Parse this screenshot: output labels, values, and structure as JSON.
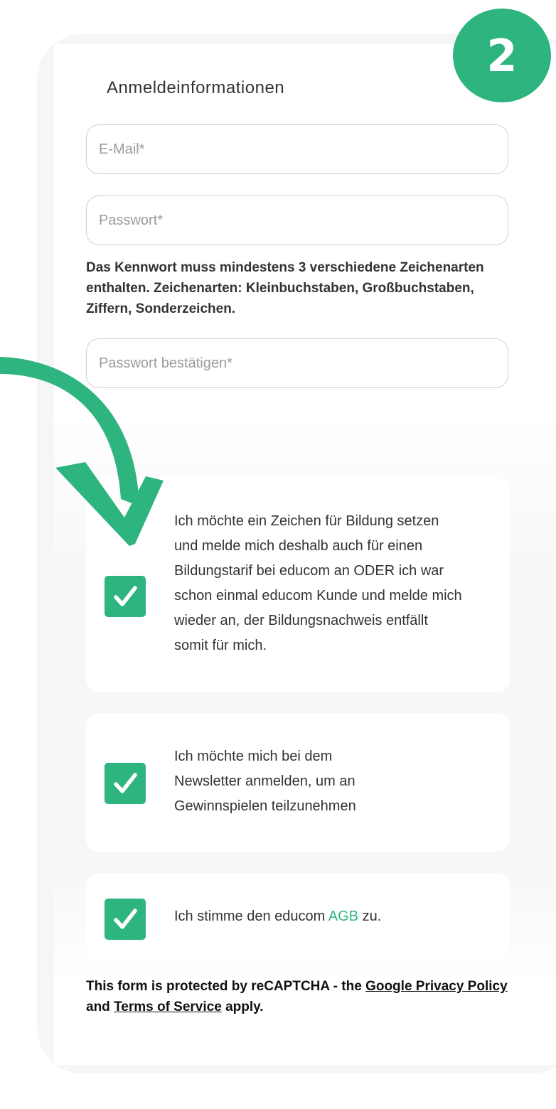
{
  "step": {
    "number": "2"
  },
  "section": {
    "title": "Anmeldeinformationen"
  },
  "fields": {
    "email_placeholder": "E-Mail*",
    "password_placeholder": "Passwort*",
    "password_confirm_placeholder": "Passwort bestätigen*"
  },
  "password_hint": "Das Kennwort muss mindestens 3 verschiedene Zeichenarten enthalten. Zeichenarten: Kleinbuchstaben, Großbuchstaben, Ziffern, Sonderzeichen.",
  "consents": {
    "education": {
      "checked": true,
      "text": "Ich möchte ein Zeichen für Bildung setzen und melde mich deshalb auch für einen Bildungstarif bei educom an ODER ich war schon einmal educom Kunde und melde mich wieder an, der Bildungsnachweis entfällt somit für mich."
    },
    "newsletter": {
      "checked": true,
      "text": "Ich möchte mich bei dem Newsletter anmelden, um an Gewinnspielen teilzunehmen"
    },
    "terms": {
      "checked": true,
      "text_before": "Ich stimme den educom ",
      "link": "AGB",
      "text_after": " zu."
    }
  },
  "recaptcha": {
    "text_before": "This form is protected by reCAPTCHA - the ",
    "privacy_link": "Google Privacy Policy",
    "text_middle": " and ",
    "terms_link": "Terms of Service",
    "text_after": " apply."
  },
  "colors": {
    "accent": "#2eb47f",
    "field_border": "#cfcfcf"
  },
  "icons": [
    "check-icon",
    "arrow-down-icon"
  ]
}
